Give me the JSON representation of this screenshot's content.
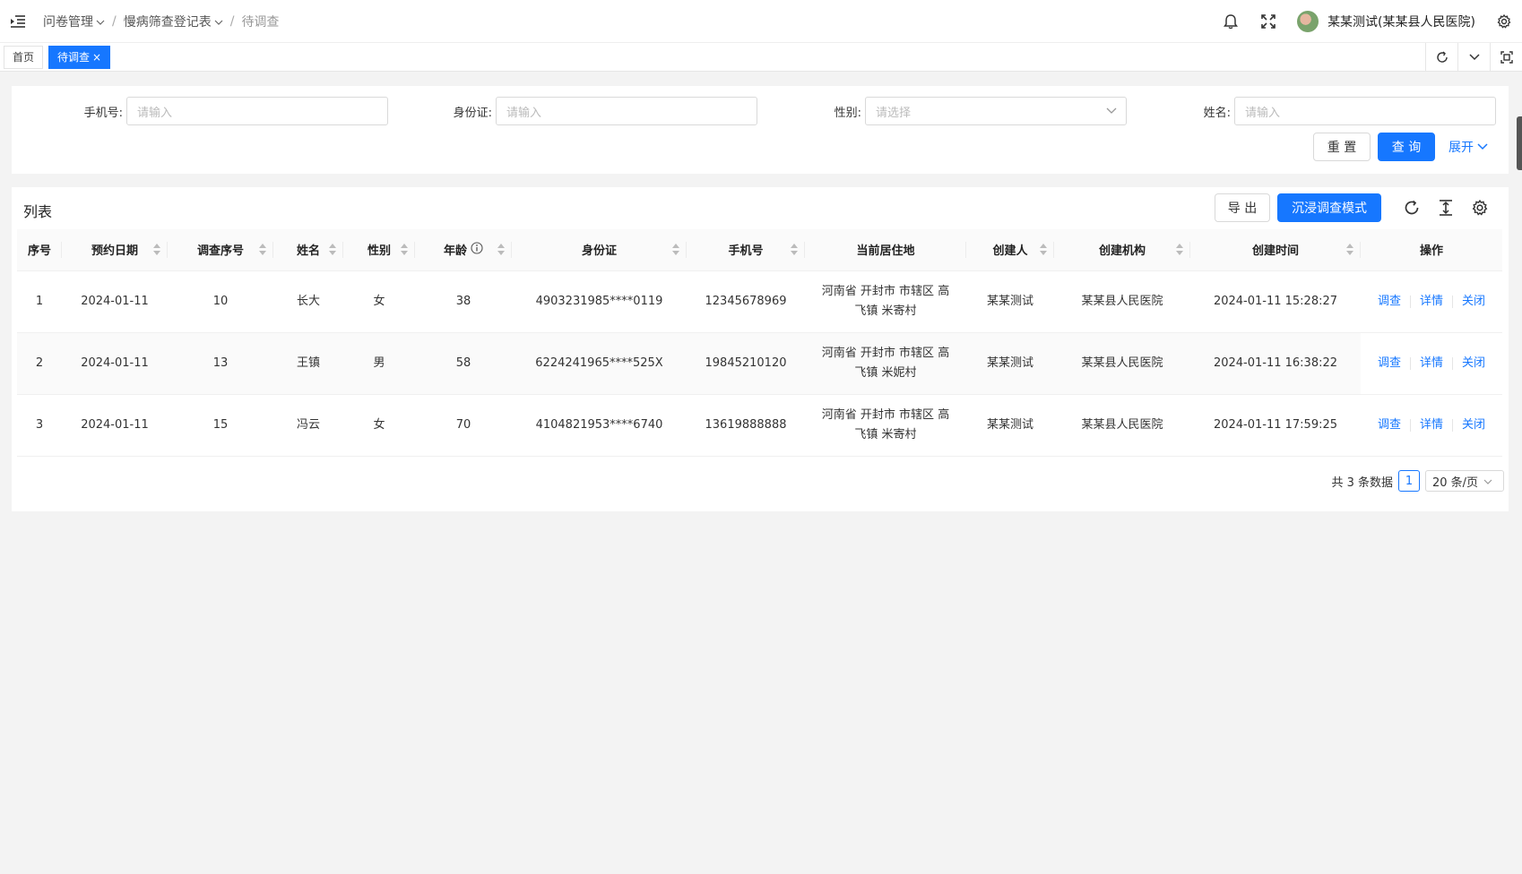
{
  "header": {
    "breadcrumb": [
      {
        "label": "问卷管理",
        "has_dropdown": true
      },
      {
        "label": "慢病筛查登记表",
        "has_dropdown": true
      },
      {
        "label": "待调查",
        "has_dropdown": false
      }
    ],
    "user_name": "某某测试(某某县人民医院)",
    "icons": [
      "menu-fold-icon",
      "bell-icon",
      "fullscreen-icon",
      "avatar",
      "gear-icon"
    ]
  },
  "tabs": {
    "items": [
      {
        "label": "首页",
        "active": false
      },
      {
        "label": "待调查",
        "active": true,
        "close": "×"
      }
    ],
    "tools": [
      "refresh-icon",
      "chevron-down-icon",
      "maximize-icon"
    ]
  },
  "filter": {
    "fields": [
      {
        "label": "手机号:",
        "placeholder": "请输入"
      },
      {
        "label": "身份证:",
        "placeholder": "请输入"
      },
      {
        "label": "性别:",
        "placeholder": "请选择"
      },
      {
        "label": "姓名:",
        "placeholder": "请输入"
      }
    ],
    "reset_label": "重 置",
    "query_label": "查 询",
    "expand_label": "展开"
  },
  "list": {
    "title": "列表",
    "export_label": "导 出",
    "immersive_label": "沉浸调查模式",
    "columns": [
      "序号",
      "预约日期",
      "调查序号",
      "姓名",
      "性别",
      "年龄",
      "身份证",
      "手机号",
      "当前居住地",
      "创建人",
      "创建机构",
      "创建时间",
      "操作"
    ],
    "rows": [
      {
        "no": "1",
        "date": "2024-01-11",
        "survey_no": "10",
        "name": "长大",
        "gender": "女",
        "age": "38",
        "id_card": "4903231985****0119",
        "phone": "12345678969",
        "address_line1": "河南省 开封市 市辖区 高",
        "address_line2": "飞镇 米寄村",
        "creator": "某某测试",
        "org": "某某县人民医院",
        "created": "2024-01-11 15:28:27"
      },
      {
        "no": "2",
        "date": "2024-01-11",
        "survey_no": "13",
        "name": "王镇",
        "gender": "男",
        "age": "58",
        "id_card": "6224241965****525X",
        "phone": "19845210120",
        "address_line1": "河南省 开封市 市辖区 高",
        "address_line2": "飞镇 米妮村",
        "creator": "某某测试",
        "org": "某某县人民医院",
        "created": "2024-01-11 16:38:22"
      },
      {
        "no": "3",
        "date": "2024-01-11",
        "survey_no": "15",
        "name": "冯云",
        "gender": "女",
        "age": "70",
        "id_card": "4104821953****6740",
        "phone": "13619888888",
        "address_line1": "河南省 开封市 市辖区 高",
        "address_line2": "飞镇 米寄村",
        "creator": "某某测试",
        "org": "某某县人民医院",
        "created": "2024-01-11 17:59:25"
      }
    ],
    "actions": [
      "调查",
      "详情",
      "关闭"
    ]
  },
  "pagination": {
    "total_text": "共 3 条数据",
    "current_page": "1",
    "page_size": "20 条/页"
  },
  "colors": {
    "primary": "#1677ff",
    "background": "#f3f3f3"
  }
}
